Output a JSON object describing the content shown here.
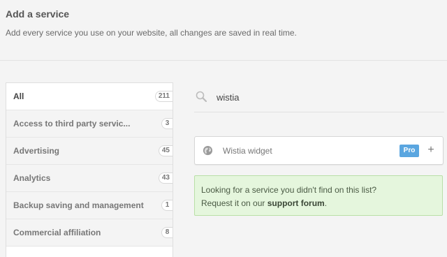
{
  "header": {
    "title": "Add a service",
    "subtitle": "Add every service you use on your website, all changes are saved in real time."
  },
  "categories": [
    {
      "label": "All",
      "count": "211",
      "active": true
    },
    {
      "label": "Access to third party servic...",
      "count": "3"
    },
    {
      "label": "Advertising",
      "count": "45"
    },
    {
      "label": "Analytics",
      "count": "43"
    },
    {
      "label": "Backup saving and management",
      "count": "1"
    },
    {
      "label": "Commercial affiliation",
      "count": "8"
    }
  ],
  "search": {
    "icon": "search-icon",
    "value": "wistia"
  },
  "results": [
    {
      "icon": "globe-icon",
      "name": "Wistia widget",
      "badge": "Pro",
      "action_icon": "plus-icon",
      "action_label": "+"
    }
  ],
  "notice": {
    "line1": "Looking for a service you didn't find on this list?",
    "line2_prefix": "Request it on our ",
    "link": "support forum",
    "line2_suffix": "."
  },
  "colors": {
    "pro_badge": "#5aa6e0",
    "notice_bg": "#e5f6dd",
    "notice_border": "#b9dfa7"
  }
}
